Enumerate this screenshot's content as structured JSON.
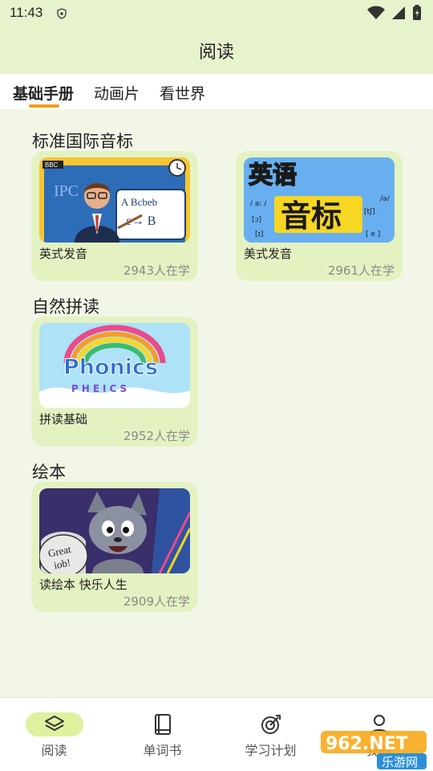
{
  "status_bar": {
    "time": "11:43"
  },
  "app_bar": {
    "title": "阅读"
  },
  "tabs": [
    {
      "label": "基础手册",
      "active": true
    },
    {
      "label": "动画片",
      "active": false
    },
    {
      "label": "看世界",
      "active": false
    }
  ],
  "sections": [
    {
      "title": "标准国际音标",
      "cards": [
        {
          "name": "英式发音",
          "count": "2943人在学",
          "thumb_text": [
            "BBC",
            "IPC",
            "A Bcbeb",
            "ε→ B"
          ]
        },
        {
          "name": "美式发音",
          "count": "2961人在学",
          "thumb_text": [
            "英语",
            "音标"
          ]
        }
      ]
    },
    {
      "title": "自然拼读",
      "cards": [
        {
          "name": "拼读基础",
          "count": "2952人在学",
          "thumb_text": [
            "Phonics",
            "PHEICS"
          ]
        }
      ]
    },
    {
      "title": "绘本",
      "cards": [
        {
          "name": "读绘本 快乐人生",
          "count": "2909人在学",
          "thumb_text": [
            "Great",
            "iob!"
          ]
        }
      ]
    }
  ],
  "bottom_nav": [
    {
      "label": "阅读",
      "icon": "layers-icon",
      "active": true
    },
    {
      "label": "单词书",
      "icon": "book-icon",
      "active": false
    },
    {
      "label": "学习计划",
      "icon": "target-icon",
      "active": false
    },
    {
      "label": "我的",
      "icon": "person-icon",
      "active": false
    }
  ],
  "watermark": {
    "text": "962.NET",
    "subtext": "乐游网"
  }
}
